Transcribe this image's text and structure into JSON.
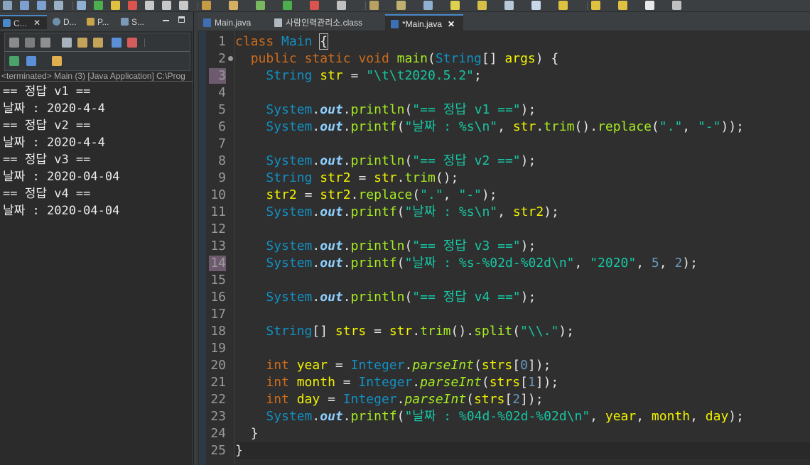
{
  "toolbar": {
    "icons": [
      "view-menu-icon",
      "save-icon",
      "save-all-icon",
      "print-icon",
      "skip-breakpoints-icon",
      "resume-icon",
      "suspend-icon",
      "terminate-icon",
      "step-into-icon",
      "step-over-icon",
      "step-return-icon",
      "new-java-project-icon",
      "new-package-icon",
      "debug-icon",
      "run-icon",
      "coverage-icon",
      "external-tools-icon",
      "open-type-icon",
      "open-task-icon",
      "search-icon",
      "annotation-icon",
      "mark-occurrences-icon",
      "block-selection-icon",
      "show-whitespace-icon",
      "next-annotation-icon",
      "prev-annotation-icon",
      "back-icon",
      "forward-icon",
      "pin-editor-icon"
    ]
  },
  "left_pane": {
    "tabs": [
      {
        "label": "C...",
        "icon": "console-icon",
        "active": true
      },
      {
        "label": "D...",
        "icon": "debug-view-icon",
        "active": false
      },
      {
        "label": "P...",
        "icon": "package-explorer-icon",
        "active": false
      },
      {
        "label": "S...",
        "icon": "servers-icon",
        "active": false
      }
    ],
    "close_glyph": "✕",
    "status": "<terminated> Main (3) [Java Application] C:\\Prog",
    "output": [
      "== 정답 v1 ==",
      "날짜 : 2020-4-4",
      "== 정답 v2 ==",
      "날짜 : 2020-4-4",
      "== 정답 v3 ==",
      "날짜 : 2020-04-04",
      "== 정답 v4 ==",
      "날짜 : 2020-04-04"
    ]
  },
  "editor": {
    "tabs": [
      {
        "label": "Main.java",
        "icon": "java-file-icon",
        "active": false
      },
      {
        "label": "사람인력관리소.class",
        "icon": "class-file-icon",
        "active": false
      },
      {
        "label": "*Main.java",
        "icon": "java-file-icon",
        "active": true
      }
    ],
    "close_glyph": "✕",
    "line_numbers": [
      "1",
      "2",
      "3",
      "4",
      "5",
      "6",
      "7",
      "8",
      "9",
      "10",
      "11",
      "12",
      "13",
      "14",
      "15",
      "16",
      "17",
      "18",
      "19",
      "20",
      "21",
      "22",
      "23",
      "24",
      "25"
    ],
    "code_lines": [
      "class Main {",
      "  public static void main(String[] args) {",
      "    String str = \"\\t\\t2020.5.2\";",
      "",
      "    System.out.println(\"== 정답 v1 ==\");",
      "    System.out.printf(\"날짜 : %s\\n\", str.trim().replace(\".\", \"-\"));",
      "",
      "    System.out.println(\"== 정답 v2 ==\");",
      "    String str2 = str.trim();",
      "    str2 = str2.replace(\".\", \"-\");",
      "    System.out.printf(\"날짜 : %s\\n\", str2);",
      "",
      "    System.out.println(\"== 정답 v3 ==\");",
      "    System.out.printf(\"날짜 : %s-%02d-%02d\\n\", \"2020\", 5, 2);",
      "",
      "    System.out.println(\"== 정답 v4 ==\");",
      "",
      "    String[] strs = str.trim().split(\"\\\\.\");",
      "",
      "    int year = Integer.parseInt(strs[0]);",
      "    int month = Integer.parseInt(strs[1]);",
      "    int day = Integer.parseInt(strs[2]);",
      "    System.out.printf(\"날짜 : %04d-%02d-%02d\\n\", year, month, day);",
      "  }",
      "}"
    ]
  }
}
